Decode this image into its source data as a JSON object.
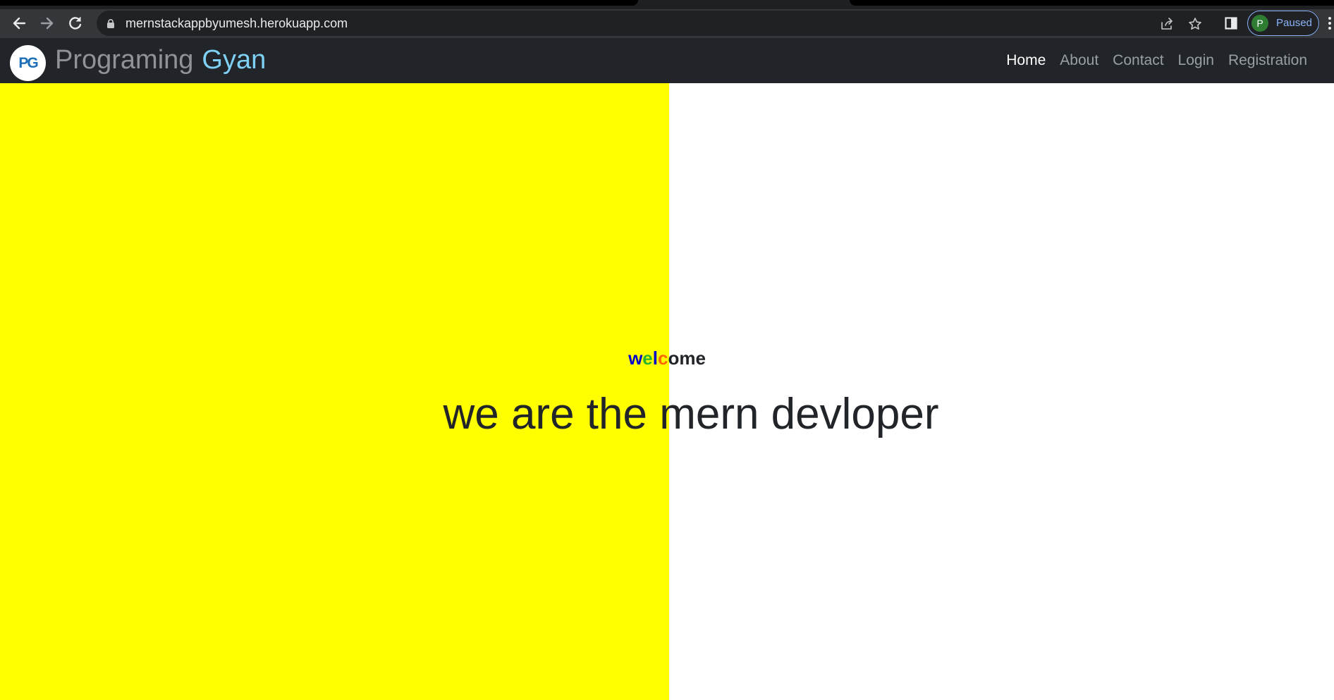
{
  "browser": {
    "url": "mernstackappbyumesh.herokuapp.com",
    "profile_initial": "P",
    "profile_status": "Paused",
    "icons": [
      "back-icon",
      "forward-icon",
      "reload-icon",
      "lock-icon",
      "share-icon",
      "star-icon",
      "side-panel-icon",
      "menu-icon"
    ]
  },
  "navbar": {
    "logo_text": "PG",
    "brand_part1": "Programing",
    "brand_part2": "Gyan",
    "links": [
      {
        "label": "Home",
        "active": true
      },
      {
        "label": "About",
        "active": false
      },
      {
        "label": "Contact",
        "active": false
      },
      {
        "label": "Login",
        "active": false
      },
      {
        "label": "Registration",
        "active": false
      }
    ]
  },
  "hero": {
    "welcome_part1": "w",
    "welcome_part2": "e",
    "welcome_part3": "l",
    "welcome_part4": "c",
    "welcome_part5": "ome",
    "headline": "we are the mern devloper"
  },
  "colors": {
    "navbar_bg": "#212529",
    "hero_left_bg": "#ffff00",
    "brand_accent": "#7ed1f5"
  }
}
